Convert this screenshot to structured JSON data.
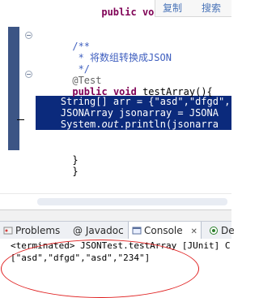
{
  "popup": {
    "copy_label": "复制",
    "search_label": "搜索"
  },
  "code": {
    "lines": [
      "/**",
      " * 将数组转换成JSON",
      " */",
      "@Test",
      "public void testArray(){",
      "",
      "    String[] arr = {\"asd\",\"dfgd\",",
      "    JSONArray jsonarray = JSONA",
      "    System.out.println(jsonarra",
      "",
      "}",
      "}"
    ],
    "truncated_top": "public void testArra..."
  },
  "tabs": [
    {
      "label": "Problems",
      "icon": "problems-icon"
    },
    {
      "label": "@ Javadoc",
      "icon": "javadoc-icon"
    },
    {
      "label": "Console",
      "icon": "console-icon",
      "active": true,
      "close": "✕"
    },
    {
      "label": "De",
      "icon": "declaration-icon"
    }
  ],
  "console": {
    "header": "<terminated> JSONTest.testArray [JUnit] C:\\Pro",
    "output": "[\"asd\",\"dfgd\",\"asd\",\"234\"]"
  },
  "colors": {
    "selection": "#0b2a7c",
    "keyword": "#7f0055",
    "comment": "#3f5fbf",
    "annotation_circle": "#e02020"
  }
}
